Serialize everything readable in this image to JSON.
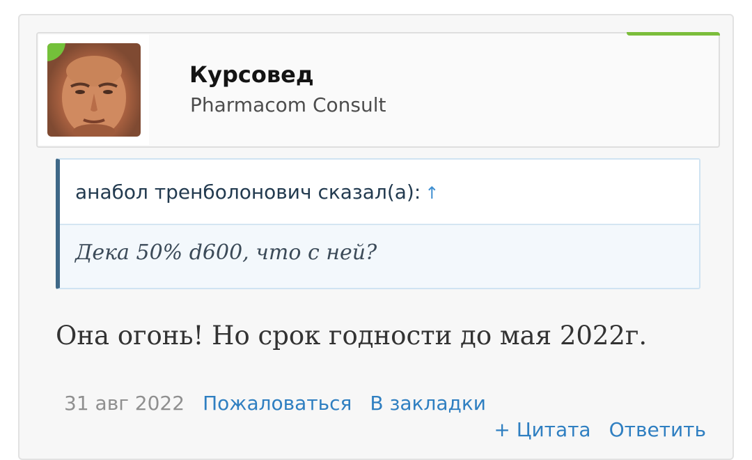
{
  "post": {
    "user": {
      "name": "Курсовед",
      "title": "Pharmacom Consult",
      "avatar_icon": "user-avatar-photo",
      "online_color": "#74c13a"
    },
    "quote": {
      "author": "анабол тренболонович сказал(а):",
      "jump_icon": "↑",
      "text": "Дека 50% d600, что с ней?"
    },
    "message": "Она огонь! Но срок годности до мая 2022г.",
    "meta": {
      "date": "31 авг 2022",
      "report_label": "Пожаловаться",
      "bookmark_label": "В закладки"
    },
    "actions": {
      "quote_label": "+ Цитата",
      "reply_label": "Ответить"
    }
  },
  "colors": {
    "link": "#2f7fc1",
    "accent_green": "#7bbd3b",
    "quote_border": "#3f6887"
  }
}
